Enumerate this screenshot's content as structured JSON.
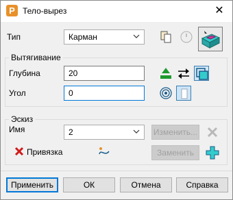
{
  "window": {
    "title": "Тело-вырез",
    "app_icon_letter": "P",
    "close_glyph": "✕"
  },
  "type": {
    "label": "Тип",
    "selected": "Карман"
  },
  "extrude": {
    "group_title": "Вытягивание",
    "depth_label": "Глубина",
    "depth_value": "20",
    "angle_label": "Угол",
    "angle_value": "0"
  },
  "sketch": {
    "group_title": "Эскиз",
    "name_label": "Имя",
    "name_selected": "2",
    "edit_label": "Изменить...",
    "replace_label": "Заменить",
    "binding_label": "Привязка"
  },
  "footer": {
    "apply": "Применить",
    "ok": "ОК",
    "cancel": "Отмена",
    "help": "Справка"
  },
  "colors": {
    "accent": "#0078d7",
    "cyan_icon": "#33cccc",
    "green_icon": "#1e9a2e",
    "error_red": "#d01a1a"
  }
}
